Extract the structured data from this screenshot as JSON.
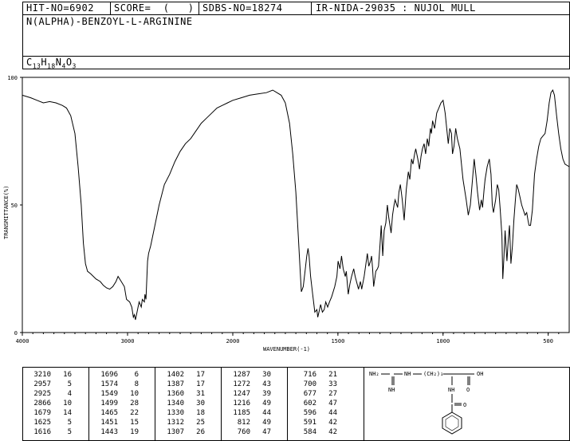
{
  "header": {
    "hit_no": "HIT-NO=6902",
    "score": "SCORE=  (   )",
    "sdbs_no": "SDBS-NO=18274",
    "ir_info": "IR-NIDA-29035 : NUJOL MULL",
    "compound_name": "N(ALPHA)-BENZOYL-L-ARGININE",
    "formula": {
      "C": "C",
      "c_sub": "13",
      "H": "H",
      "h_sub": "18",
      "N": "N",
      "n_sub": "4",
      "O": "O",
      "o_sub": "3"
    }
  },
  "chart_data": {
    "type": "line",
    "title": "",
    "xlabel": "WAVENUMBER(-1)",
    "ylabel": "TRANSMITTANCE(%)",
    "xlim": [
      4000,
      400
    ],
    "ylim": [
      0,
      100
    ],
    "x_ticks": [
      "4000",
      "3000",
      "2000",
      "1500",
      "1000",
      "500"
    ],
    "x_tick_values": [
      4000,
      3000,
      2000,
      1500,
      1000,
      500
    ],
    "y_ticks": [
      "100",
      "50",
      "0"
    ],
    "y_tick_values": [
      100,
      50,
      0
    ],
    "series": [
      {
        "color": "#000000",
        "points": [
          [
            4000,
            93
          ],
          [
            3920,
            92
          ],
          [
            3860,
            91
          ],
          [
            3800,
            90
          ],
          [
            3740,
            90.5
          ],
          [
            3680,
            90
          ],
          [
            3620,
            89
          ],
          [
            3580,
            88
          ],
          [
            3540,
            85
          ],
          [
            3500,
            78
          ],
          [
            3470,
            65
          ],
          [
            3440,
            50
          ],
          [
            3420,
            35
          ],
          [
            3400,
            27
          ],
          [
            3380,
            24
          ],
          [
            3350,
            23
          ],
          [
            3300,
            21
          ],
          [
            3260,
            20
          ],
          [
            3230,
            18.5
          ],
          [
            3200,
            17.5
          ],
          [
            3170,
            17
          ],
          [
            3140,
            18
          ],
          [
            3110,
            20
          ],
          [
            3090,
            22
          ],
          [
            3060,
            20
          ],
          [
            3030,
            18
          ],
          [
            3010,
            13
          ],
          [
            2980,
            12
          ],
          [
            2960,
            10
          ],
          [
            2945,
            6
          ],
          [
            2935,
            7
          ],
          [
            2925,
            5
          ],
          [
            2910,
            8
          ],
          [
            2890,
            12
          ],
          [
            2870,
            10
          ],
          [
            2860,
            13
          ],
          [
            2840,
            12
          ],
          [
            2835,
            15
          ],
          [
            2825,
            13
          ],
          [
            2810,
            28
          ],
          [
            2800,
            31
          ],
          [
            2780,
            34
          ],
          [
            2750,
            40
          ],
          [
            2700,
            50
          ],
          [
            2650,
            58
          ],
          [
            2600,
            62
          ],
          [
            2550,
            67
          ],
          [
            2500,
            71
          ],
          [
            2450,
            74
          ],
          [
            2400,
            76
          ],
          [
            2350,
            79
          ],
          [
            2300,
            82
          ],
          [
            2250,
            84
          ],
          [
            2200,
            86
          ],
          [
            2150,
            88
          ],
          [
            2100,
            89
          ],
          [
            2050,
            90
          ],
          [
            2000,
            91
          ],
          [
            1960,
            92
          ],
          [
            1920,
            93
          ],
          [
            1880,
            93.5
          ],
          [
            1840,
            94
          ],
          [
            1810,
            95
          ],
          [
            1790,
            94
          ],
          [
            1770,
            93
          ],
          [
            1750,
            90
          ],
          [
            1730,
            82
          ],
          [
            1715,
            70
          ],
          [
            1700,
            55
          ],
          [
            1690,
            40
          ],
          [
            1680,
            25
          ],
          [
            1674,
            16
          ],
          [
            1665,
            18
          ],
          [
            1655,
            25
          ],
          [
            1648,
            30
          ],
          [
            1642,
            33
          ],
          [
            1637,
            30
          ],
          [
            1630,
            22
          ],
          [
            1620,
            15
          ],
          [
            1610,
            8
          ],
          [
            1600,
            9
          ],
          [
            1596,
            6
          ],
          [
            1590,
            8
          ],
          [
            1582,
            11
          ],
          [
            1574,
            8
          ],
          [
            1565,
            9
          ],
          [
            1558,
            12
          ],
          [
            1549,
            10
          ],
          [
            1540,
            12
          ],
          [
            1530,
            14
          ],
          [
            1515,
            18
          ],
          [
            1505,
            22
          ],
          [
            1499,
            28
          ],
          [
            1490,
            25
          ],
          [
            1483,
            30
          ],
          [
            1475,
            25
          ],
          [
            1465,
            22
          ],
          [
            1460,
            24
          ],
          [
            1451,
            15
          ],
          [
            1443,
            19
          ],
          [
            1435,
            22
          ],
          [
            1425,
            25
          ],
          [
            1418,
            22
          ],
          [
            1402,
            17
          ],
          [
            1393,
            20
          ],
          [
            1387,
            17
          ],
          [
            1375,
            22
          ],
          [
            1360,
            31
          ],
          [
            1353,
            26
          ],
          [
            1345,
            28
          ],
          [
            1340,
            30
          ],
          [
            1335,
            25
          ],
          [
            1330,
            18
          ],
          [
            1320,
            24
          ],
          [
            1312,
            25
          ],
          [
            1307,
            26
          ],
          [
            1300,
            34
          ],
          [
            1294,
            42
          ],
          [
            1287,
            30
          ],
          [
            1280,
            40
          ],
          [
            1272,
            43
          ],
          [
            1265,
            50
          ],
          [
            1258,
            45
          ],
          [
            1247,
            39
          ],
          [
            1240,
            46
          ],
          [
            1233,
            50
          ],
          [
            1228,
            52
          ],
          [
            1216,
            49
          ],
          [
            1210,
            55
          ],
          [
            1203,
            58
          ],
          [
            1194,
            52
          ],
          [
            1185,
            44
          ],
          [
            1175,
            56
          ],
          [
            1165,
            63
          ],
          [
            1158,
            60
          ],
          [
            1150,
            68
          ],
          [
            1143,
            66
          ],
          [
            1135,
            70
          ],
          [
            1130,
            72
          ],
          [
            1120,
            68
          ],
          [
            1112,
            64
          ],
          [
            1105,
            69
          ],
          [
            1098,
            72
          ],
          [
            1090,
            74
          ],
          [
            1083,
            70
          ],
          [
            1075,
            76
          ],
          [
            1068,
            73
          ],
          [
            1060,
            80
          ],
          [
            1055,
            78
          ],
          [
            1050,
            83
          ],
          [
            1040,
            80
          ],
          [
            1030,
            86
          ],
          [
            1020,
            88
          ],
          [
            1010,
            90
          ],
          [
            1000,
            91
          ],
          [
            990,
            86
          ],
          [
            980,
            78
          ],
          [
            975,
            74
          ],
          [
            968,
            80
          ],
          [
            960,
            78
          ],
          [
            955,
            70
          ],
          [
            948,
            73
          ],
          [
            940,
            80
          ],
          [
            932,
            76
          ],
          [
            920,
            72
          ],
          [
            905,
            60
          ],
          [
            890,
            52
          ],
          [
            880,
            46
          ],
          [
            870,
            50
          ],
          [
            860,
            60
          ],
          [
            852,
            68
          ],
          [
            844,
            62
          ],
          [
            836,
            55
          ],
          [
            826,
            48
          ],
          [
            818,
            52
          ],
          [
            812,
            49
          ],
          [
            805,
            56
          ],
          [
            800,
            60
          ],
          [
            790,
            65
          ],
          [
            780,
            68
          ],
          [
            772,
            62
          ],
          [
            766,
            50
          ],
          [
            760,
            47
          ],
          [
            750,
            52
          ],
          [
            742,
            58
          ],
          [
            735,
            56
          ],
          [
            728,
            48
          ],
          [
            720,
            38
          ],
          [
            716,
            21
          ],
          [
            710,
            30
          ],
          [
            705,
            40
          ],
          [
            700,
            33
          ],
          [
            696,
            28
          ],
          [
            690,
            36
          ],
          [
            684,
            42
          ],
          [
            677,
            27
          ],
          [
            670,
            34
          ],
          [
            663,
            44
          ],
          [
            656,
            52
          ],
          [
            650,
            58
          ],
          [
            642,
            56
          ],
          [
            634,
            53
          ],
          [
            626,
            50
          ],
          [
            618,
            48
          ],
          [
            610,
            46
          ],
          [
            602,
            47
          ],
          [
            596,
            44
          ],
          [
            591,
            42
          ],
          [
            584,
            42
          ],
          [
            575,
            48
          ],
          [
            565,
            62
          ],
          [
            555,
            68
          ],
          [
            545,
            73
          ],
          [
            535,
            76
          ],
          [
            525,
            77
          ],
          [
            515,
            78
          ],
          [
            505,
            83
          ],
          [
            495,
            90
          ],
          [
            487,
            94
          ],
          [
            478,
            95
          ],
          [
            470,
            93
          ],
          [
            460,
            85
          ],
          [
            450,
            78
          ],
          [
            440,
            72
          ],
          [
            430,
            68
          ],
          [
            420,
            66
          ],
          [
            400,
            65
          ]
        ]
      }
    ]
  },
  "peak_table": {
    "columns": [
      {
        "wn": [
          "3210",
          "2957",
          "2925",
          "2866",
          "1679",
          "1625",
          "1616"
        ],
        "t": [
          "16",
          "5",
          "4",
          "10",
          "14",
          "5",
          "5"
        ]
      },
      {
        "wn": [
          "1696",
          "1574",
          "1549",
          "1499",
          "1465",
          "1451",
          "1443"
        ],
        "t": [
          "6",
          "8",
          "10",
          "28",
          "22",
          "15",
          "19"
        ]
      },
      {
        "wn": [
          "1402",
          "1387",
          "1360",
          "1340",
          "1330",
          "1312",
          "1307"
        ],
        "t": [
          "17",
          "17",
          "31",
          "30",
          "18",
          "25",
          "26"
        ]
      },
      {
        "wn": [
          "1287",
          "1272",
          "1247",
          "1216",
          "1185",
          "812",
          "760"
        ],
        "t": [
          "30",
          "43",
          "39",
          "49",
          "44",
          "49",
          "47"
        ]
      },
      {
        "wn": [
          "716",
          "700",
          "677",
          "602",
          "596",
          "591",
          "584"
        ],
        "t": [
          "21",
          "33",
          "27",
          "47",
          "44",
          "42",
          "42"
        ]
      }
    ]
  },
  "structure": {
    "nh2": "NH₂",
    "nh": "NH",
    "nh_chain": "NH",
    "ch2_3": "(CH₂)₃",
    "oh": "OH",
    "o_carboxyl": "O",
    "nh_amide": "NH",
    "o_amide": "O"
  }
}
